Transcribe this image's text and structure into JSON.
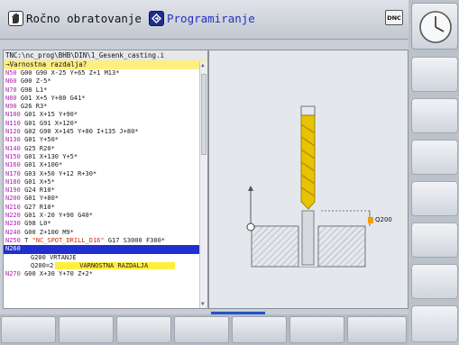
{
  "header": {
    "mode_manual": "Ročno obratovanje",
    "mode_program": "Programiranje",
    "dnc_label": "DNC"
  },
  "program": {
    "path": "TNC:\\nc_prog\\BHB\\DIN\\1_Gesenk_casting.i",
    "hint": "→Varnostna razdalja?",
    "lines": [
      {
        "n": "N50",
        "t": " G00 G90 X-25 Y+65 Z+1 M13*"
      },
      {
        "n": "N60",
        "t": " G00 Z-5*"
      },
      {
        "n": "N70",
        "t": " G98 L1*"
      },
      {
        "n": "N80",
        "t": " G01 X+5 Y+80 G41*"
      },
      {
        "n": "N90",
        "t": " G26 R3*"
      },
      {
        "n": "N100",
        "t": " G01 X+15 Y+90*"
      },
      {
        "n": "N110",
        "t": " G01 G91 X+120*"
      },
      {
        "n": "N120",
        "t": " G02 G90 X+145 Y+80 I+135 J+80*"
      },
      {
        "n": "N130",
        "t": " G01 Y+50*"
      },
      {
        "n": "N140",
        "t": " G25 R20*"
      },
      {
        "n": "N150",
        "t": " G01 X+130 Y+5*"
      },
      {
        "n": "N160",
        "t": " G01 X+100*"
      },
      {
        "n": "N170",
        "t": " G03 X+50 Y+12 R+30*"
      },
      {
        "n": "N180",
        "t": " G01 X+5*"
      },
      {
        "n": "N190",
        "t": " G24 R10*"
      },
      {
        "n": "N200",
        "t": " G01 Y+80*"
      },
      {
        "n": "N210",
        "t": " G27 R10*"
      },
      {
        "n": "N220",
        "t": " G01 X-20 Y+90 G40*"
      },
      {
        "n": "N230",
        "t": " G98 L0*"
      },
      {
        "n": "N240",
        "t": " G00 Z+100 M9*"
      },
      {
        "n": "N250",
        "t": " T ",
        "s": "\"NC_SPOT_DRILL_D16\"",
        "t2": " G17 S3000 F300*"
      }
    ],
    "selected_line": "N260",
    "cycle_line": "G200 VRTANJE",
    "param_name": "Q200=2",
    "param_label": "VARNOSTNA RAZDALJA",
    "last_line_n": "N270",
    "last_line_t": " G00 X+30 Y+70 Z+2*"
  },
  "graphic": {
    "param_tag": "Q200"
  },
  "colors": {
    "accent_blue": "#1f2fd0",
    "line_number": "#b01fb0",
    "string_red": "#d03000",
    "hint_yellow": "#ffee80",
    "drill_yellow": "#e8c300"
  },
  "icons": {
    "manual": "hand-icon",
    "programming": "program-edit-icon",
    "clock": "clock-icon"
  }
}
